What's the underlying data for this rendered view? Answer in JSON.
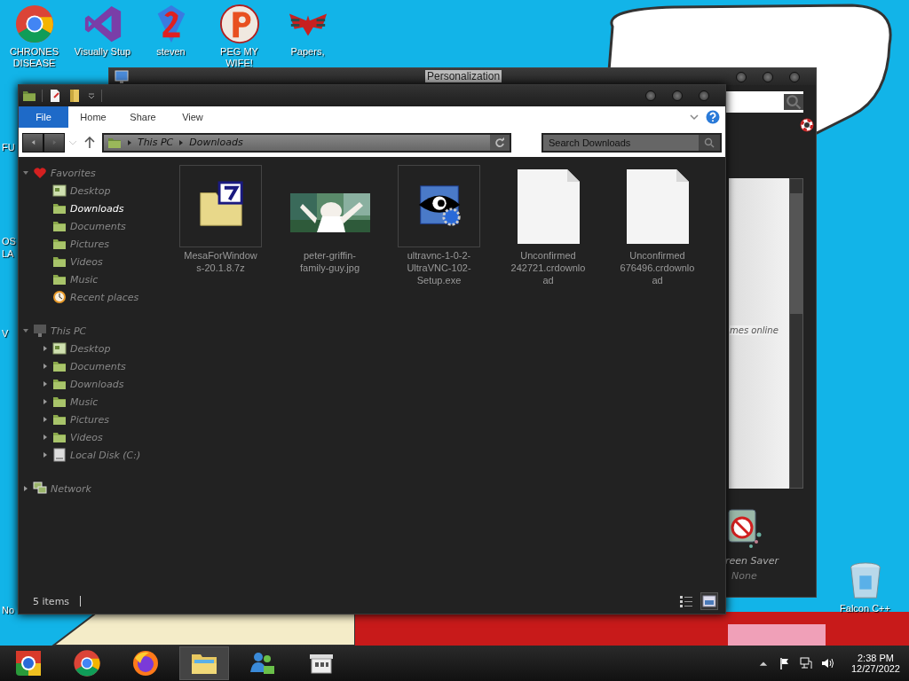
{
  "desktop": {
    "icons": [
      {
        "label": "CHRONES DISEASE",
        "kind": "chrome"
      },
      {
        "label": "Visually Stup",
        "kind": "studio"
      },
      {
        "label": "steven",
        "kind": "two"
      },
      {
        "label": "PEG MY WIFE!",
        "kind": "p"
      },
      {
        "label": "Papers,",
        "kind": "eagle"
      }
    ],
    "edge_labels": [
      "FU",
      "OS",
      "LA",
      "V",
      "No"
    ],
    "right_icons": [
      {
        "label": "Falcon C++",
        "kind": "bin"
      }
    ]
  },
  "background_window": {
    "title": "Personalization",
    "link_text": "mes online",
    "screen_saver": {
      "label": "reen Saver",
      "value": "None"
    }
  },
  "explorer": {
    "ribbon_tabs": [
      {
        "label": "File",
        "selected": true
      },
      {
        "label": "Home",
        "selected": false
      },
      {
        "label": "Share",
        "selected": false
      },
      {
        "label": "View",
        "selected": false
      }
    ],
    "breadcrumb": [
      "This PC",
      "Downloads"
    ],
    "search": {
      "placeholder": "Search Downloads"
    },
    "nav": [
      {
        "label": "Favorites",
        "kind": "heart",
        "expanded": true,
        "selected": false,
        "children": [
          {
            "label": "Desktop",
            "kind": "desktop",
            "selected": false
          },
          {
            "label": "Downloads",
            "kind": "folder",
            "selected": true
          },
          {
            "label": "Documents",
            "kind": "folder",
            "selected": false
          },
          {
            "label": "Pictures",
            "kind": "folder",
            "selected": false
          },
          {
            "label": "Videos",
            "kind": "folder",
            "selected": false
          },
          {
            "label": "Music",
            "kind": "folder",
            "selected": false
          },
          {
            "label": "Recent places",
            "kind": "clock",
            "selected": false
          }
        ]
      },
      {
        "label": "This PC",
        "kind": "pc",
        "expanded": true,
        "selected": false,
        "children": [
          {
            "label": "Desktop",
            "kind": "desktop",
            "expanded": false,
            "selected": false
          },
          {
            "label": "Documents",
            "kind": "folder",
            "expanded": false,
            "selected": false
          },
          {
            "label": "Downloads",
            "kind": "folder",
            "expanded": false,
            "selected": false
          },
          {
            "label": "Music",
            "kind": "folder",
            "expanded": false,
            "selected": false
          },
          {
            "label": "Pictures",
            "kind": "folder",
            "expanded": false,
            "selected": false
          },
          {
            "label": "Videos",
            "kind": "folder",
            "expanded": false,
            "selected": false
          },
          {
            "label": "Local Disk (C:)",
            "kind": "disk",
            "expanded": false,
            "selected": false
          }
        ]
      },
      {
        "label": "Network",
        "kind": "network",
        "expanded": false,
        "selected": false
      }
    ],
    "files": [
      {
        "name": "MesaForWindows-20.1.8.7z",
        "kind": "archive",
        "selected": true
      },
      {
        "name": "peter-griffin-family-guy.jpg",
        "kind": "picture",
        "selected": false
      },
      {
        "name": "ultravnc-1-0-2-UltraVNC-102-Setup.exe",
        "kind": "installer",
        "selected": true
      },
      {
        "name": "Unconfirmed 242721.crdownload",
        "kind": "blank",
        "selected": false
      },
      {
        "name": "Unconfirmed 676496.crdownload",
        "kind": "blank",
        "selected": false
      }
    ],
    "status": "5 items",
    "views": [
      {
        "kind": "details",
        "selected": false
      },
      {
        "kind": "large",
        "selected": true
      }
    ]
  },
  "taskbar": {
    "apps": [
      {
        "kind": "start",
        "active": false
      },
      {
        "kind": "chrome",
        "active": false
      },
      {
        "kind": "firefox",
        "active": false
      },
      {
        "kind": "explorer",
        "active": true
      },
      {
        "kind": "messenger",
        "active": false
      },
      {
        "kind": "store",
        "active": false
      }
    ],
    "time": "2:38 PM",
    "date": "12/27/2022"
  }
}
